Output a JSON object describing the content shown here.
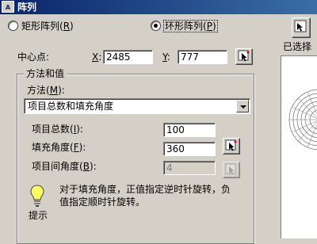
{
  "window": {
    "title": "阵列",
    "app_icon_text": "A"
  },
  "radios": {
    "rect": {
      "label": "矩形阵列",
      "accel": "R",
      "selected": false
    },
    "polar": {
      "label": "环形阵列",
      "accel": "P",
      "selected": true
    }
  },
  "select_objects": {
    "label": "已选择"
  },
  "center": {
    "label": "中心点:",
    "x_accel": "X",
    "x_value": "2485",
    "y_accel": "Y",
    "y_value": "777"
  },
  "method_group": {
    "title": "方法和值",
    "method_label": "方法",
    "method_accel": "M",
    "method_value": "项目总数和填充角度",
    "total_items": {
      "label": "项目总数",
      "accel": "I",
      "value": "100"
    },
    "fill_angle": {
      "label": "填充角度",
      "accel": "F",
      "value": "360"
    },
    "angle_between": {
      "label": "项目间角度",
      "accel": "B",
      "value": "4",
      "disabled": true
    }
  },
  "tip": {
    "title": "提示",
    "line1": "对于填充角度，正值指定逆时针旋转，负",
    "line2": "值指定顺时针旋转。"
  }
}
